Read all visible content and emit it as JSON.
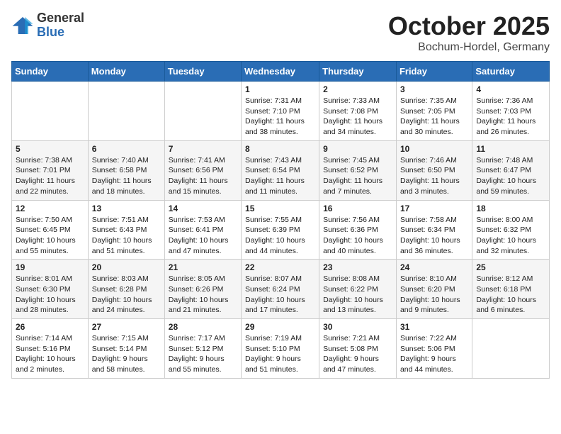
{
  "header": {
    "logo_general": "General",
    "logo_blue": "Blue",
    "month": "October 2025",
    "location": "Bochum-Hordel, Germany"
  },
  "weekdays": [
    "Sunday",
    "Monday",
    "Tuesday",
    "Wednesday",
    "Thursday",
    "Friday",
    "Saturday"
  ],
  "weeks": [
    [
      {
        "day": "",
        "info": ""
      },
      {
        "day": "",
        "info": ""
      },
      {
        "day": "",
        "info": ""
      },
      {
        "day": "1",
        "info": "Sunrise: 7:31 AM\nSunset: 7:10 PM\nDaylight: 11 hours and 38 minutes."
      },
      {
        "day": "2",
        "info": "Sunrise: 7:33 AM\nSunset: 7:08 PM\nDaylight: 11 hours and 34 minutes."
      },
      {
        "day": "3",
        "info": "Sunrise: 7:35 AM\nSunset: 7:05 PM\nDaylight: 11 hours and 30 minutes."
      },
      {
        "day": "4",
        "info": "Sunrise: 7:36 AM\nSunset: 7:03 PM\nDaylight: 11 hours and 26 minutes."
      }
    ],
    [
      {
        "day": "5",
        "info": "Sunrise: 7:38 AM\nSunset: 7:01 PM\nDaylight: 11 hours and 22 minutes."
      },
      {
        "day": "6",
        "info": "Sunrise: 7:40 AM\nSunset: 6:58 PM\nDaylight: 11 hours and 18 minutes."
      },
      {
        "day": "7",
        "info": "Sunrise: 7:41 AM\nSunset: 6:56 PM\nDaylight: 11 hours and 15 minutes."
      },
      {
        "day": "8",
        "info": "Sunrise: 7:43 AM\nSunset: 6:54 PM\nDaylight: 11 hours and 11 minutes."
      },
      {
        "day": "9",
        "info": "Sunrise: 7:45 AM\nSunset: 6:52 PM\nDaylight: 11 hours and 7 minutes."
      },
      {
        "day": "10",
        "info": "Sunrise: 7:46 AM\nSunset: 6:50 PM\nDaylight: 11 hours and 3 minutes."
      },
      {
        "day": "11",
        "info": "Sunrise: 7:48 AM\nSunset: 6:47 PM\nDaylight: 10 hours and 59 minutes."
      }
    ],
    [
      {
        "day": "12",
        "info": "Sunrise: 7:50 AM\nSunset: 6:45 PM\nDaylight: 10 hours and 55 minutes."
      },
      {
        "day": "13",
        "info": "Sunrise: 7:51 AM\nSunset: 6:43 PM\nDaylight: 10 hours and 51 minutes."
      },
      {
        "day": "14",
        "info": "Sunrise: 7:53 AM\nSunset: 6:41 PM\nDaylight: 10 hours and 47 minutes."
      },
      {
        "day": "15",
        "info": "Sunrise: 7:55 AM\nSunset: 6:39 PM\nDaylight: 10 hours and 44 minutes."
      },
      {
        "day": "16",
        "info": "Sunrise: 7:56 AM\nSunset: 6:36 PM\nDaylight: 10 hours and 40 minutes."
      },
      {
        "day": "17",
        "info": "Sunrise: 7:58 AM\nSunset: 6:34 PM\nDaylight: 10 hours and 36 minutes."
      },
      {
        "day": "18",
        "info": "Sunrise: 8:00 AM\nSunset: 6:32 PM\nDaylight: 10 hours and 32 minutes."
      }
    ],
    [
      {
        "day": "19",
        "info": "Sunrise: 8:01 AM\nSunset: 6:30 PM\nDaylight: 10 hours and 28 minutes."
      },
      {
        "day": "20",
        "info": "Sunrise: 8:03 AM\nSunset: 6:28 PM\nDaylight: 10 hours and 24 minutes."
      },
      {
        "day": "21",
        "info": "Sunrise: 8:05 AM\nSunset: 6:26 PM\nDaylight: 10 hours and 21 minutes."
      },
      {
        "day": "22",
        "info": "Sunrise: 8:07 AM\nSunset: 6:24 PM\nDaylight: 10 hours and 17 minutes."
      },
      {
        "day": "23",
        "info": "Sunrise: 8:08 AM\nSunset: 6:22 PM\nDaylight: 10 hours and 13 minutes."
      },
      {
        "day": "24",
        "info": "Sunrise: 8:10 AM\nSunset: 6:20 PM\nDaylight: 10 hours and 9 minutes."
      },
      {
        "day": "25",
        "info": "Sunrise: 8:12 AM\nSunset: 6:18 PM\nDaylight: 10 hours and 6 minutes."
      }
    ],
    [
      {
        "day": "26",
        "info": "Sunrise: 7:14 AM\nSunset: 5:16 PM\nDaylight: 10 hours and 2 minutes."
      },
      {
        "day": "27",
        "info": "Sunrise: 7:15 AM\nSunset: 5:14 PM\nDaylight: 9 hours and 58 minutes."
      },
      {
        "day": "28",
        "info": "Sunrise: 7:17 AM\nSunset: 5:12 PM\nDaylight: 9 hours and 55 minutes."
      },
      {
        "day": "29",
        "info": "Sunrise: 7:19 AM\nSunset: 5:10 PM\nDaylight: 9 hours and 51 minutes."
      },
      {
        "day": "30",
        "info": "Sunrise: 7:21 AM\nSunset: 5:08 PM\nDaylight: 9 hours and 47 minutes."
      },
      {
        "day": "31",
        "info": "Sunrise: 7:22 AM\nSunset: 5:06 PM\nDaylight: 9 hours and 44 minutes."
      },
      {
        "day": "",
        "info": ""
      }
    ]
  ]
}
